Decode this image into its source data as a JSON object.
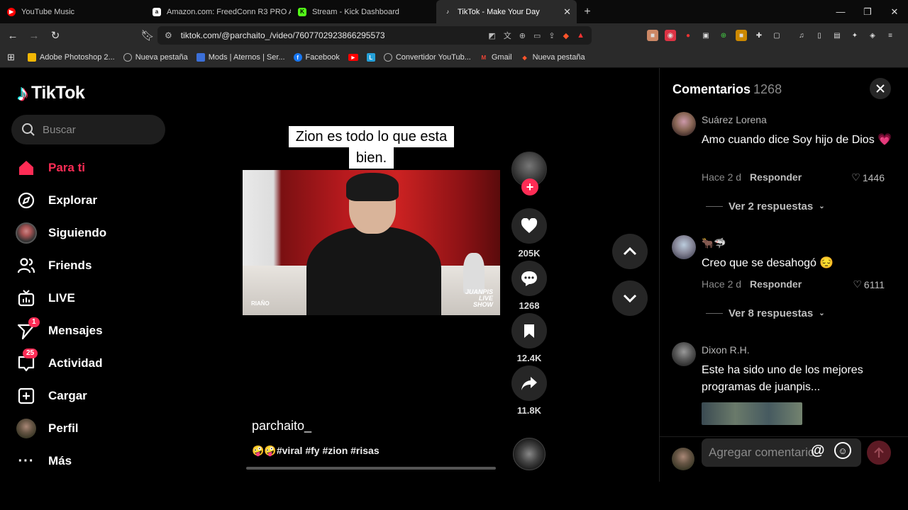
{
  "browser": {
    "tabs": [
      {
        "label": "YouTube Music",
        "icon": "youtube-music-icon",
        "color": "#ff0000"
      },
      {
        "label": "Amazon.com: FreedConn R3 PRO Au",
        "icon": "amazon-icon",
        "color": "#ffffff"
      },
      {
        "label": "Stream - Kick Dashboard",
        "icon": "kick-icon",
        "color": "#53fc18"
      },
      {
        "label": "TikTok - Make Your Day",
        "icon": "tiktok-icon",
        "color": "#ffffff",
        "active": true
      }
    ],
    "url": "tiktok.com/@parchaito_/video/7607702923866295573",
    "bookmarks": [
      {
        "label": "Adobe Photoshop 2...",
        "color": "#f2b705"
      },
      {
        "label": "Nueva pestaña",
        "color": "#aaaaaa"
      },
      {
        "label": "Mods | Aternos | Ser...",
        "color": "#3b6fd8"
      },
      {
        "label": "Facebook",
        "color": "#1877f2"
      },
      {
        "label": "",
        "color": "#ff0000"
      },
      {
        "label": "",
        "color": "#25a0d8"
      },
      {
        "label": "Convertidor YouTub...",
        "color": "#aaaaaa"
      },
      {
        "label": "Gmail",
        "color": "#ea4335"
      },
      {
        "label": "Nueva pestaña",
        "color": "#fb542b"
      }
    ]
  },
  "tiktok": {
    "logo": "TikTok",
    "search_placeholder": "Buscar",
    "nav": [
      {
        "label": "Para ti",
        "icon": "home-icon",
        "selected": true
      },
      {
        "label": "Explorar",
        "icon": "compass-icon"
      },
      {
        "label": "Siguiendo",
        "icon": "following-avatar"
      },
      {
        "label": "Friends",
        "icon": "friends-icon"
      },
      {
        "label": "LIVE",
        "icon": "live-icon"
      },
      {
        "label": "Mensajes",
        "icon": "messages-icon",
        "badge": "1"
      },
      {
        "label": "Actividad",
        "icon": "activity-icon",
        "badge": "25"
      },
      {
        "label": "Cargar",
        "icon": "upload-icon"
      },
      {
        "label": "Perfil",
        "icon": "profile-avatar"
      },
      {
        "label": "Más",
        "icon": "more-icon"
      }
    ],
    "accent": "#fe2c55"
  },
  "video": {
    "caption_line1": "Zion es todo lo que esta",
    "caption_line2": "bien.",
    "overlay_left": "RIAÑO",
    "overlay_right_1": "JUANPIS",
    "overlay_right_2": "LIVE",
    "overlay_right_3": "SHOW",
    "author": "parchaito_",
    "description": "🤪🤪#viral #fy #zion #risas",
    "likes": "205K",
    "comments": "1268",
    "saves": "12.4K",
    "shares": "11.8K"
  },
  "comments": {
    "title": "Comentarios",
    "count": "1268",
    "items": [
      {
        "user": "Suárez Lorena",
        "text": "Amo cuando dice Soy hijo de Dios 💗",
        "time": "Hace 2 d",
        "reply": "Responder",
        "likes": "1446",
        "more": "Ver 2 respuestas"
      },
      {
        "user": "🐂🦈",
        "text": "Creo que se desahogó 😔",
        "time": "Hace 2 d",
        "reply": "Responder",
        "likes": "6111",
        "more": "Ver 8 respuestas"
      },
      {
        "user": "Dixon R.H.",
        "text": "Este ha sido uno de los mejores programas de juanpis..."
      }
    ],
    "input_placeholder": "Agregar comentario..."
  }
}
